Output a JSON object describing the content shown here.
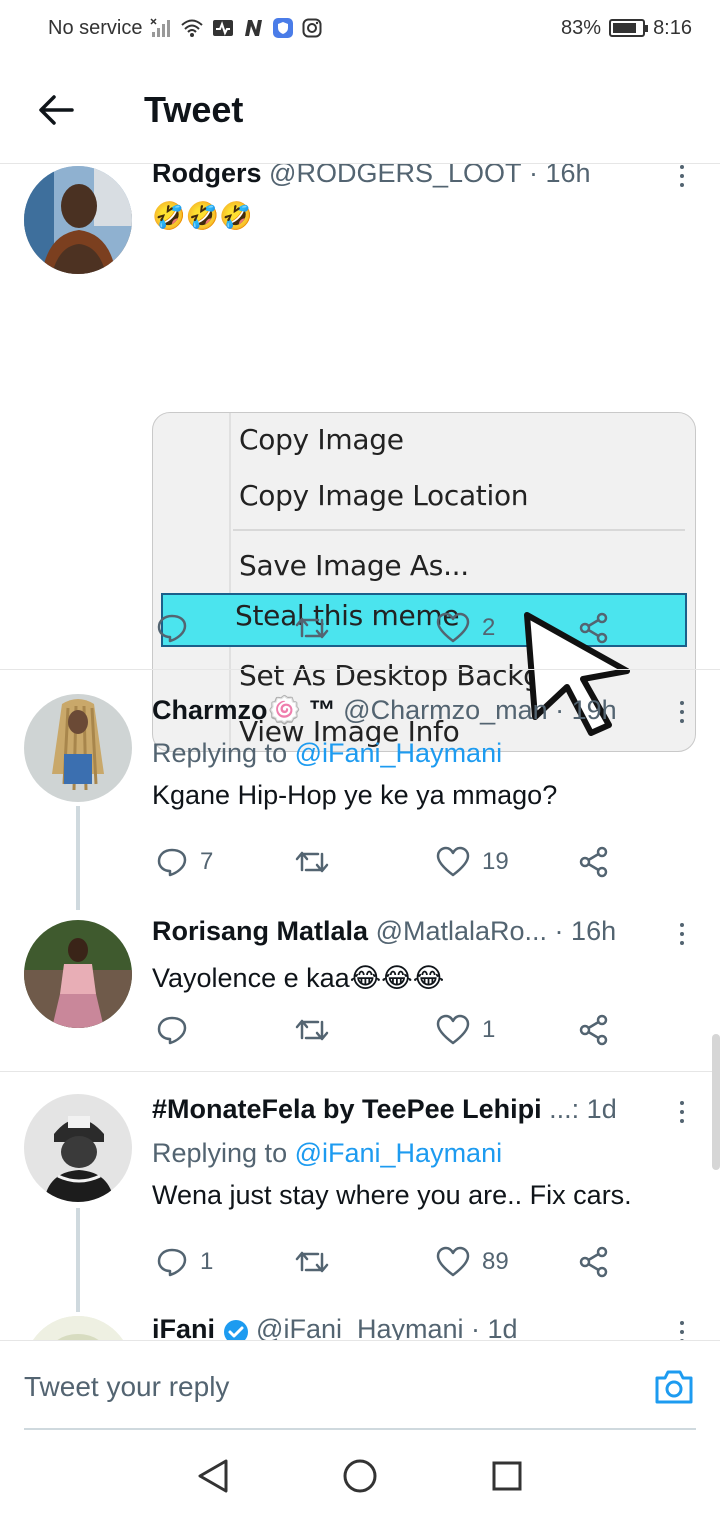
{
  "status_bar": {
    "carrier": "No service",
    "battery": "83%",
    "battery_level": 0.83,
    "time": "8:16"
  },
  "header": {
    "title": "Tweet"
  },
  "tweets": [
    {
      "name": "Rodgers",
      "handle": "@RODGERS_LOOT",
      "time": "16h",
      "text": "🤣🤣🤣",
      "image_menu": [
        "Copy Image",
        "Copy Image Location",
        "Save Image As...",
        "Steal this meme",
        "Set As Desktop Backgro",
        "View Image Info"
      ],
      "likes": "2"
    },
    {
      "name": "Charmzo🍥 ™",
      "handle": "@Charmzo_man",
      "time": "19h",
      "replying_label": "Replying to",
      "replying_to": "@iFani_Haymani",
      "text": "Kgane Hip-Hop ye ke ya mmago?",
      "replies": "7",
      "likes": "19"
    },
    {
      "name": "Rorisang Matlala",
      "handle": "@MatlalaRo...",
      "time": "16h",
      "text": "Vayolence e kaa😂😂😂",
      "likes": "1"
    },
    {
      "name": "#MonateFela by TeePee Lehipi",
      "handle": "...",
      "time": "1d",
      "replying_label": "Replying to",
      "replying_to": "@iFani_Haymani",
      "text": "Wena just stay where you are.. Fix cars.",
      "replies": "1",
      "likes": "89"
    },
    {
      "name": "iFani",
      "handle": "@iFani_Haymani",
      "time": "1d"
    }
  ],
  "composer": {
    "placeholder": "Tweet your reply"
  },
  "icons": {
    "back": "arrow-left-icon",
    "reply": "reply-icon",
    "retweet": "retweet-icon",
    "like": "heart-icon",
    "share": "share-icon",
    "camera": "camera-icon",
    "verified": "verified-badge-icon"
  },
  "colors": {
    "accent": "#1d9bf0",
    "secondary_text": "#536471",
    "highlight": "#4be4ee"
  }
}
